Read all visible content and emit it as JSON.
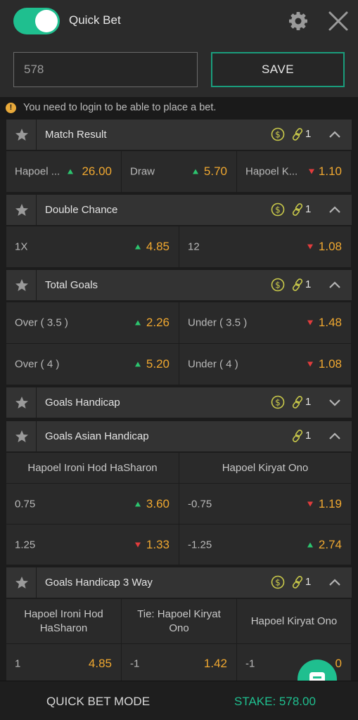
{
  "header": {
    "quick_bet_label": "Quick Bet",
    "toggle_on": true
  },
  "stake": {
    "value": "578",
    "save_label": "SAVE"
  },
  "warning": {
    "text": "You need to login to be able to place a bet."
  },
  "markets": {
    "match_result": {
      "title": "Match Result",
      "count": "1",
      "outcomes": [
        {
          "label": "Hapoel ...",
          "odds": "26.00",
          "trend": "up"
        },
        {
          "label": "Draw",
          "odds": "5.70",
          "trend": "up"
        },
        {
          "label": "Hapoel K...",
          "odds": "1.10",
          "trend": "down"
        }
      ]
    },
    "double_chance": {
      "title": "Double Chance",
      "count": "1",
      "outcomes": [
        {
          "label": "1X",
          "odds": "4.85",
          "trend": "up"
        },
        {
          "label": "12",
          "odds": "1.08",
          "trend": "down"
        }
      ]
    },
    "total_goals": {
      "title": "Total Goals",
      "count": "1",
      "rows": [
        [
          {
            "label": "Over ( 3.5 )",
            "odds": "2.26",
            "trend": "up"
          },
          {
            "label": "Under ( 3.5 )",
            "odds": "1.48",
            "trend": "down"
          }
        ],
        [
          {
            "label": "Over ( 4 )",
            "odds": "5.20",
            "trend": "up"
          },
          {
            "label": "Under ( 4 )",
            "odds": "1.08",
            "trend": "down"
          }
        ]
      ]
    },
    "goals_handicap": {
      "title": "Goals Handicap",
      "count": "1"
    },
    "goals_asian_handicap": {
      "title": "Goals Asian Handicap",
      "count": "1",
      "headers": [
        "Hapoel Ironi Hod HaSharon",
        "Hapoel Kiryat Ono"
      ],
      "rows": [
        [
          {
            "label": "0.75",
            "odds": "3.60",
            "trend": "up"
          },
          {
            "label": "-0.75",
            "odds": "1.19",
            "trend": "down"
          }
        ],
        [
          {
            "label": "1.25",
            "odds": "1.33",
            "trend": "down"
          },
          {
            "label": "-1.25",
            "odds": "2.74",
            "trend": "up"
          }
        ]
      ]
    },
    "goals_handicap_3way": {
      "title": "Goals Handicap 3 Way",
      "count": "1",
      "headers": [
        "Hapoel Ironi Hod HaSharon",
        "Tie: Hapoel Kiryat Ono",
        "Hapoel Kiryat Ono"
      ],
      "row": [
        {
          "label": "1",
          "odds": "4.85"
        },
        {
          "label": "-1",
          "odds": "1.42"
        },
        {
          "label": "-1",
          "odds": "0"
        }
      ]
    }
  },
  "footer": {
    "mode_label": "QUICK BET MODE",
    "stake_label": "STAKE: 578.00"
  },
  "colors": {
    "accent": "#1fbf8f",
    "odds": "#f0a830",
    "up": "#2cc56f",
    "down": "#e23c3c",
    "icon": "#c9c94a"
  }
}
